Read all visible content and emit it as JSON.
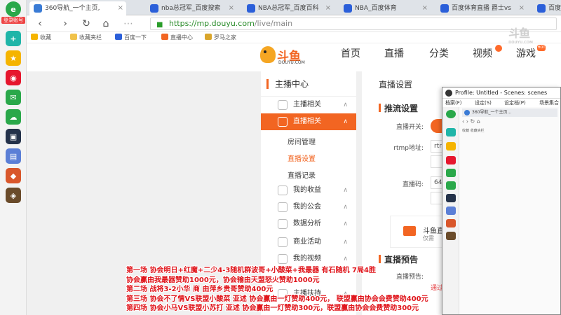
{
  "browser": {
    "login_label": "登录账号",
    "tabs": [
      {
        "title": "360导航_一个主页,",
        "color": "#3a7bd5"
      },
      {
        "title": "nba总冠军_百度搜索",
        "color": "#2b5fd9"
      },
      {
        "title": "NBA总冠军_百度百科",
        "color": "#2b5fd9"
      },
      {
        "title": "NBA_百度体育",
        "color": "#2b5fd9"
      },
      {
        "title": "百度体育直播 爵士vs",
        "color": "#2b5fd9"
      },
      {
        "title": "百度",
        "color": "#2b5fd9"
      }
    ],
    "url_scheme": "https://",
    "url_host": "mp.douyu.com",
    "url_path": "/live/main",
    "bookmarks": [
      "收藏",
      "收藏夹栏",
      "百度一下",
      "直播中心",
      "罗马之家"
    ]
  },
  "watermark": {
    "text": "斗鱼",
    "sub": "DOUYU.COM"
  },
  "douyu": {
    "logo_text": "斗鱼",
    "logo_sub": "DOUYU.COM",
    "nav": [
      "首页",
      "直播",
      "分类",
      "视频",
      "游戏"
    ],
    "hot_badge": "HOT"
  },
  "menu": {
    "title": "主播中心",
    "items": [
      {
        "label": "主播相关",
        "chevron": "∧"
      },
      {
        "label": "直播相关",
        "chevron": "∧"
      },
      {
        "label": "我的收益",
        "chevron": "∧"
      },
      {
        "label": "我的公会",
        "chevron": "∧"
      },
      {
        "label": "数据分析",
        "chevron": "∧"
      },
      {
        "label": "商业活动",
        "chevron": "∧"
      },
      {
        "label": "我的视频",
        "chevron": "∧"
      },
      {
        "label": "主播扶持",
        "chevron": "∧"
      }
    ],
    "subitems": [
      "房间管理",
      "直播设置",
      "直播记录"
    ]
  },
  "panel": {
    "title": "直播设置",
    "section1": "推流设置",
    "toggle_label": "直播开关:",
    "rtmp_label": "rtmp地址:",
    "rtmp_value": "rtr",
    "code_label": "直播码:",
    "code_value": "64",
    "promo_title": "斗鱼直",
    "promo_sub": "仅需",
    "section2": "直播预告",
    "preview_label": "直播预告:",
    "red_link": "通过"
  },
  "obs": {
    "title": "Profile: Untitled - Scenes: scenes",
    "menu": [
      "档案(F)",
      "设定(S)",
      "设定档(P)",
      "场景集合"
    ],
    "tab_text": "360导航_一个主页...",
    "bm_text": "收藏  收藏夹栏"
  },
  "overlay": [
    "第一场  协会明日+红魔+二少4-3随机群波哥+小酸菜+我最器 有石随机 7局4胜",
    "协会赢由我最器赞助1000元，协会输由天盟怒火赞助1000元",
    "第二场  战将3-2小华  商  由萍乡贵哥赞助400元",
    "第三场  协会不了情VS联盟小酸菜    亚述  协会赢由一灯赞助400元，  联盟赢由协会会费赞助400元",
    "第四场  协会小马VS联盟小苏打   亚述  协会赢由一灯赞助300元，联盟赢由协会会费赞助300元"
  ]
}
